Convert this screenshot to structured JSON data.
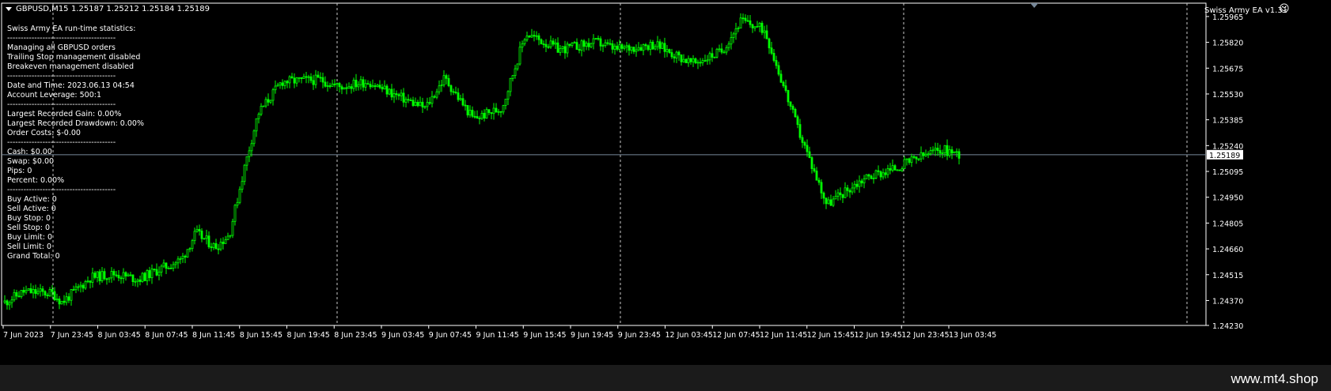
{
  "colors": {
    "background": "#000000",
    "candle": "#00ff00",
    "grid": "#c8c8c8",
    "bid_line": "#778899",
    "text": "#ffffff",
    "footer": "#1b1b1b"
  },
  "chart": {
    "symbol_timeframe": "GBPUSD,M15",
    "ohlc": "1.25187 1.25212 1.25184 1.25189",
    "ea_label": "Swiss Army EA v1.31",
    "smiley_icon": "smiley-icon",
    "current_price_label": "1.25189"
  },
  "stats_lines": [
    "Swiss Army EA run-time statistics:",
    "----------------------------------------",
    "Managing all GBPUSD orders",
    "Trailing Stop management disabled",
    "Breakeven management disabled",
    "----------------------------------------",
    "Date and Time:  2023.06.13 04:54",
    "Account Leverage:  500:1",
    "----------------------------------------",
    "Largest Recorded Gain:  0.00%",
    "Largest Recorded Drawdown:  0.00%",
    "Order Costs:  $-0.00",
    "----------------------------------------",
    "Cash:  $0.00",
    "Swap:  $0.00",
    "Pips:  0",
    "Percent:  0.00%",
    "----------------------------------------",
    "Buy Active:  0",
    "Sell Active:  0",
    "Buy Stop:  0",
    "Sell Stop:  0",
    "Buy Limit:  0",
    "Sell Limit:  0",
    "Grand Total:  0"
  ],
  "footer": {
    "brand": "www.mt4.shop"
  },
  "chart_data": {
    "type": "candlestick",
    "symbol": "GBPUSD",
    "timeframe": "M15",
    "y_axis_ticks": [
      "1.25965",
      "1.25820",
      "1.25675",
      "1.25530",
      "1.25385",
      "1.25240",
      "1.25095",
      "1.24950",
      "1.24805",
      "1.24660",
      "1.24515",
      "1.24370",
      "1.24230"
    ],
    "ylim": [
      1.2423,
      1.2604
    ],
    "current_price": 1.25189,
    "x_axis_ticks": [
      "7 Jun 2023",
      "7 Jun 23:45",
      "8 Jun 03:45",
      "8 Jun 07:45",
      "8 Jun 11:45",
      "8 Jun 15:45",
      "8 Jun 19:45",
      "8 Jun 23:45",
      "9 Jun 03:45",
      "9 Jun 07:45",
      "9 Jun 11:45",
      "9 Jun 15:45",
      "9 Jun 19:45",
      "9 Jun 23:45",
      "12 Jun 03:45",
      "12 Jun 07:45",
      "12 Jun 11:45",
      "12 Jun 15:45",
      "12 Jun 19:45",
      "12 Jun 23:45",
      "13 Jun 03:45"
    ],
    "price_path": [
      [
        0,
        1.2436
      ],
      [
        0.02,
        1.2442
      ],
      [
        0.05,
        1.2441
      ],
      [
        0.06,
        1.2436
      ],
      [
        0.09,
        1.245
      ],
      [
        0.115,
        1.2452
      ],
      [
        0.14,
        1.2449
      ],
      [
        0.16,
        1.2454
      ],
      [
        0.185,
        1.246
      ],
      [
        0.2,
        1.2475
      ],
      [
        0.22,
        1.2467
      ],
      [
        0.235,
        1.2474
      ],
      [
        0.25,
        1.251
      ],
      [
        0.265,
        1.2542
      ],
      [
        0.29,
        1.256
      ],
      [
        0.33,
        1.2561
      ],
      [
        0.35,
        1.2557
      ],
      [
        0.38,
        1.256
      ],
      [
        0.41,
        1.2552
      ],
      [
        0.44,
        1.2545
      ],
      [
        0.46,
        1.2562
      ],
      [
        0.49,
        1.2539
      ],
      [
        0.52,
        1.2545
      ],
      [
        0.545,
        1.2587
      ],
      [
        0.58,
        1.2578
      ],
      [
        0.62,
        1.2582
      ],
      [
        0.64,
        1.2578
      ],
      [
        0.68,
        1.2581
      ],
      [
        0.72,
        1.257
      ],
      [
        0.75,
        1.2577
      ],
      [
        0.77,
        1.2594
      ],
      [
        0.795,
        1.2589
      ],
      [
        0.83,
        1.2533
      ],
      [
        0.86,
        1.2491
      ],
      [
        0.9,
        1.2506
      ],
      [
        0.93,
        1.2511
      ],
      [
        0.96,
        1.2518
      ],
      [
        0.98,
        1.2522
      ],
      [
        1.0,
        1.2519
      ]
    ]
  }
}
